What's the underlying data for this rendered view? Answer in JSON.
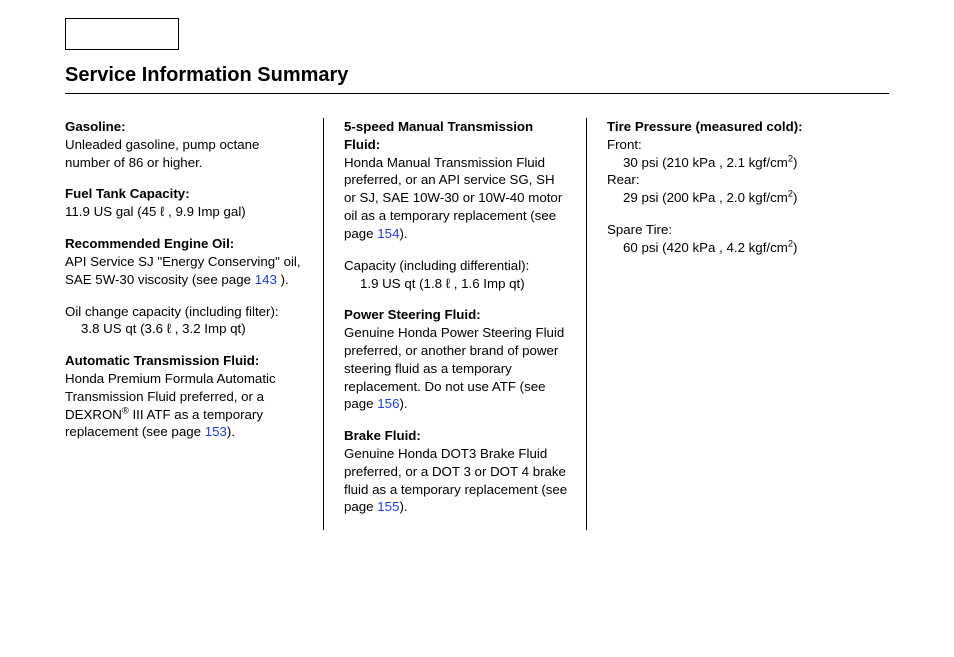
{
  "title": "Service Information Summary",
  "col1": {
    "gasoline_hd": "Gasoline:",
    "gasoline_body": "Unleaded gasoline, pump octane number of 86 or higher.",
    "fuel_cap_hd": "Fuel Tank Capacity:",
    "fuel_cap_body": "11.9 US gal (45 ℓ , 9.9 Imp gal)",
    "oil_hd": "Recommended Engine Oil:",
    "oil_body": "API Service SJ \"Energy Conserving\" oil, SAE 5W-30 viscosity (see page ",
    "oil_page": "143",
    "oil_body_end": " ).",
    "oil_change_label": "Oil change capacity (including filter):",
    "oil_change_val": "3.8 US qt (3.6 ℓ , 3.2 Imp qt)",
    "atf_hd": "Automatic Transmission Fluid:",
    "atf_body1": "Honda Premium Formula Automatic Transmission Fluid preferred, or a DEXRON",
    "atf_reg": "®",
    "atf_body2": " III ATF as a temporary replacement (see page ",
    "atf_page": "153",
    "atf_body3": ")."
  },
  "col2": {
    "mtf_hd": "5-speed Manual Transmission Fluid:",
    "mtf_body1": "Honda Manual Transmission Fluid preferred, or an API service SG, SH or SJ, SAE 10W-30 or 10W-40 motor oil as a temporary replacement (see page ",
    "mtf_page": "154",
    "mtf_body2": ").",
    "mtf_cap_label": "Capacity (including differential):",
    "mtf_cap_val": "1.9 US qt (1.8 ℓ , 1.6 Imp qt)",
    "psf_hd": "Power Steering Fluid:",
    "psf_body1": "Genuine Honda Power Steering Fluid preferred, or another brand of power steering fluid as a temporary replacement. Do not use ATF (see page ",
    "psf_page": "156",
    "psf_body2": ").",
    "brake_hd": "Brake Fluid:",
    "brake_body1": "Genuine Honda DOT3 Brake Fluid preferred, or a DOT 3 or DOT 4 brake fluid as a temporary replacement (see page ",
    "brake_page": "155",
    "brake_body2": ")."
  },
  "col3": {
    "tire_hd": "Tire Pressure (measured cold):",
    "front_label": "Front:",
    "front_val_a": "30 psi (210 kPa , 2.1 kgf/cm",
    "sup2": "2",
    "close_paren": ")",
    "rear_label": "Rear:",
    "rear_val_a": "29 psi (200 kPa , 2.0 kgf/cm",
    "spare_label": "Spare Tire:",
    "spare_val_a": "60 psi (420 kPa , 4.2 kgf/cm"
  }
}
